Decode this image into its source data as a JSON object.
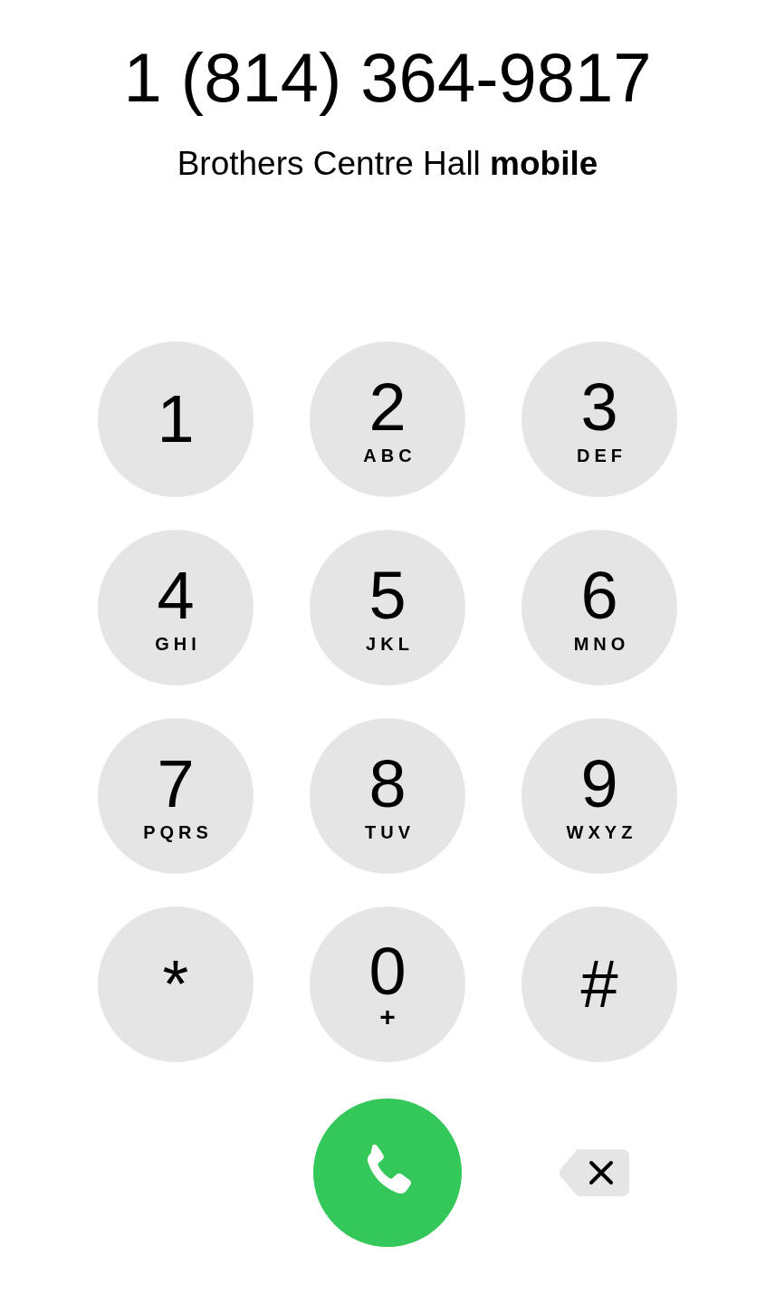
{
  "number": "1 (814) 364-9817",
  "contact": "Brothers Centre Hall **mobile**",
  "keys": [
    {
      "digit": "1"
    },
    {
      "digit": "2",
      "letters": "ABC"
    },
    {
      "digit": "3",
      "letters": "DEF"
    },
    {
      "digit": "4",
      "letters": "GHI"
    },
    {
      "digit": "5",
      "letters": "JKL"
    },
    {
      "digit": "6",
      "letters": "MNO"
    },
    {
      "digit": "7",
      "letters": "PQRS"
    },
    {
      "digit": "8",
      "letters": "TUV"
    },
    {
      "digit": "9",
      "letters": "WXYZ"
    },
    {
      "digit": "*"
    },
    {
      "digit": "0",
      "letters": "+"
    },
    {
      "digit": "#"
    }
  ]
}
